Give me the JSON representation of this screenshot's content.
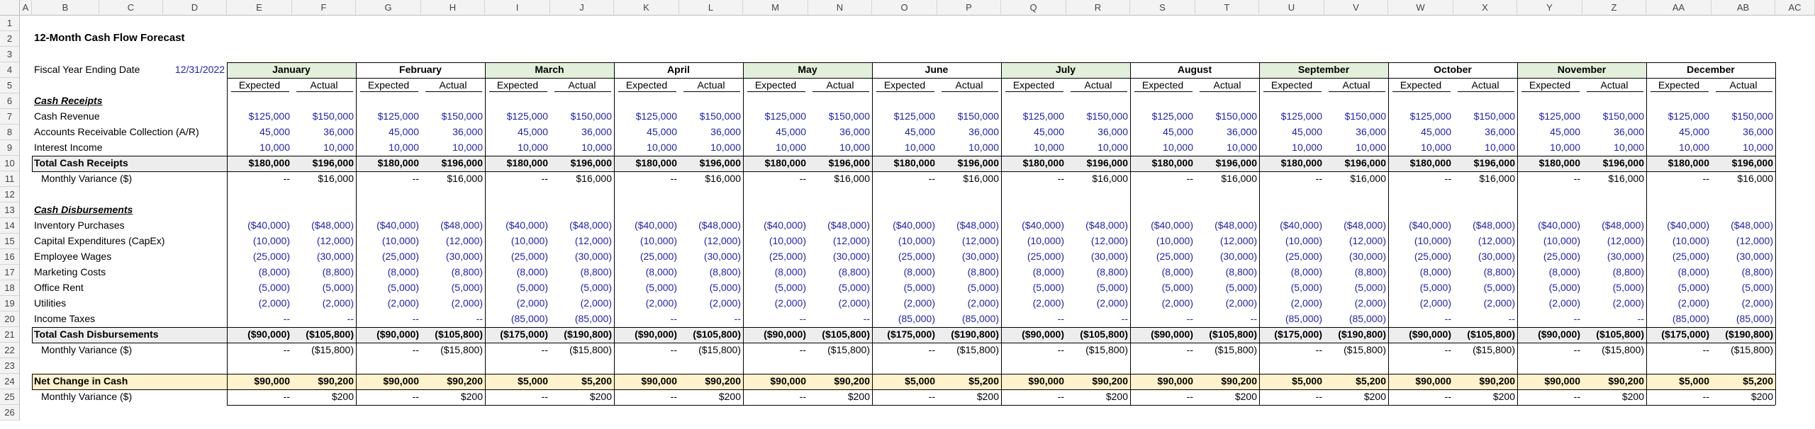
{
  "title": "12-Month Cash Flow Forecast",
  "fiscal_label": "Fiscal Year Ending Date",
  "fiscal_date": "12/31/2022",
  "col_letters": [
    "A",
    "B",
    "C",
    "D",
    "E",
    "F",
    "G",
    "H",
    "I",
    "J",
    "K",
    "L",
    "M",
    "N",
    "O",
    "P",
    "Q",
    "R",
    "S",
    "T",
    "U",
    "V",
    "W",
    "X",
    "Y",
    "Z",
    "AA",
    "AB",
    "AC"
  ],
  "row_numbers": [
    "1",
    "2",
    "3",
    "4",
    "5",
    "6",
    "7",
    "8",
    "9",
    "10",
    "11",
    "12",
    "13",
    "14",
    "15",
    "16",
    "17",
    "18",
    "19",
    "20",
    "21",
    "22",
    "23",
    "24",
    "25",
    "26"
  ],
  "months": [
    "January",
    "February",
    "March",
    "April",
    "May",
    "June",
    "July",
    "August",
    "September",
    "October",
    "November",
    "December"
  ],
  "sub_headers": {
    "expected": "Expected",
    "actual": "Actual"
  },
  "colors": {
    "green_band": "#e2efda",
    "yellow_band": "#fff2cc",
    "grey_band": "#ededed",
    "blue_text": "#1f1fb4"
  },
  "rows": [
    {
      "row": 6,
      "label": "Cash Receipts",
      "style": "section",
      "values": []
    },
    {
      "row": 7,
      "label": "Cash Revenue",
      "style": "input",
      "values": [
        "$125,000",
        "$150,000",
        "$125,000",
        "$150,000",
        "$125,000",
        "$150,000",
        "$125,000",
        "$150,000",
        "$125,000",
        "$150,000",
        "$125,000",
        "$150,000",
        "$125,000",
        "$150,000",
        "$125,000",
        "$150,000",
        "$125,000",
        "$150,000",
        "$125,000",
        "$150,000",
        "$125,000",
        "$150,000",
        "$125,000",
        "$150,000"
      ]
    },
    {
      "row": 8,
      "label": "Accounts Receivable Collection (A/R)",
      "style": "input",
      "values": [
        "45,000",
        "36,000",
        "45,000",
        "36,000",
        "45,000",
        "36,000",
        "45,000",
        "36,000",
        "45,000",
        "36,000",
        "45,000",
        "36,000",
        "45,000",
        "36,000",
        "45,000",
        "36,000",
        "45,000",
        "36,000",
        "45,000",
        "36,000",
        "45,000",
        "36,000",
        "45,000",
        "36,000"
      ]
    },
    {
      "row": 9,
      "label": "Interest Income",
      "style": "input",
      "values": [
        "10,000",
        "10,000",
        "10,000",
        "10,000",
        "10,000",
        "10,000",
        "10,000",
        "10,000",
        "10,000",
        "10,000",
        "10,000",
        "10,000",
        "10,000",
        "10,000",
        "10,000",
        "10,000",
        "10,000",
        "10,000",
        "10,000",
        "10,000",
        "10,000",
        "10,000",
        "10,000",
        "10,000"
      ]
    },
    {
      "row": 10,
      "label": "Total Cash Receipts",
      "style": "total",
      "values": [
        "$180,000",
        "$196,000",
        "$180,000",
        "$196,000",
        "$180,000",
        "$196,000",
        "$180,000",
        "$196,000",
        "$180,000",
        "$196,000",
        "$180,000",
        "$196,000",
        "$180,000",
        "$196,000",
        "$180,000",
        "$196,000",
        "$180,000",
        "$196,000",
        "$180,000",
        "$196,000",
        "$180,000",
        "$196,000",
        "$180,000",
        "$196,000"
      ]
    },
    {
      "row": 11,
      "label": "Monthly Variance ($)",
      "style": "variance",
      "values": [
        "--",
        "$16,000",
        "--",
        "$16,000",
        "--",
        "$16,000",
        "--",
        "$16,000",
        "--",
        "$16,000",
        "--",
        "$16,000",
        "--",
        "$16,000",
        "--",
        "$16,000",
        "--",
        "$16,000",
        "--",
        "$16,000",
        "--",
        "$16,000",
        "--",
        "$16,000"
      ]
    },
    {
      "row": 13,
      "label": "Cash Disbursements",
      "style": "section",
      "values": []
    },
    {
      "row": 14,
      "label": "Inventory Purchases",
      "style": "input",
      "values": [
        "($40,000)",
        "($48,000)",
        "($40,000)",
        "($48,000)",
        "($40,000)",
        "($48,000)",
        "($40,000)",
        "($48,000)",
        "($40,000)",
        "($48,000)",
        "($40,000)",
        "($48,000)",
        "($40,000)",
        "($48,000)",
        "($40,000)",
        "($48,000)",
        "($40,000)",
        "($48,000)",
        "($40,000)",
        "($48,000)",
        "($40,000)",
        "($48,000)",
        "($40,000)",
        "($48,000)"
      ]
    },
    {
      "row": 15,
      "label": "Capital Expenditures (CapEx)",
      "style": "input",
      "values": [
        "(10,000)",
        "(12,000)",
        "(10,000)",
        "(12,000)",
        "(10,000)",
        "(12,000)",
        "(10,000)",
        "(12,000)",
        "(10,000)",
        "(12,000)",
        "(10,000)",
        "(12,000)",
        "(10,000)",
        "(12,000)",
        "(10,000)",
        "(12,000)",
        "(10,000)",
        "(12,000)",
        "(10,000)",
        "(12,000)",
        "(10,000)",
        "(12,000)",
        "(10,000)",
        "(12,000)"
      ]
    },
    {
      "row": 16,
      "label": "Employee Wages",
      "style": "input",
      "values": [
        "(25,000)",
        "(30,000)",
        "(25,000)",
        "(30,000)",
        "(25,000)",
        "(30,000)",
        "(25,000)",
        "(30,000)",
        "(25,000)",
        "(30,000)",
        "(25,000)",
        "(30,000)",
        "(25,000)",
        "(30,000)",
        "(25,000)",
        "(30,000)",
        "(25,000)",
        "(30,000)",
        "(25,000)",
        "(30,000)",
        "(25,000)",
        "(30,000)",
        "(25,000)",
        "(30,000)"
      ]
    },
    {
      "row": 17,
      "label": "Marketing Costs",
      "style": "input",
      "values": [
        "(8,000)",
        "(8,800)",
        "(8,000)",
        "(8,800)",
        "(8,000)",
        "(8,800)",
        "(8,000)",
        "(8,800)",
        "(8,000)",
        "(8,800)",
        "(8,000)",
        "(8,800)",
        "(8,000)",
        "(8,800)",
        "(8,000)",
        "(8,800)",
        "(8,000)",
        "(8,800)",
        "(8,000)",
        "(8,800)",
        "(8,000)",
        "(8,800)",
        "(8,000)",
        "(8,800)"
      ]
    },
    {
      "row": 18,
      "label": "Office Rent",
      "style": "input",
      "values": [
        "(5,000)",
        "(5,000)",
        "(5,000)",
        "(5,000)",
        "(5,000)",
        "(5,000)",
        "(5,000)",
        "(5,000)",
        "(5,000)",
        "(5,000)",
        "(5,000)",
        "(5,000)",
        "(5,000)",
        "(5,000)",
        "(5,000)",
        "(5,000)",
        "(5,000)",
        "(5,000)",
        "(5,000)",
        "(5,000)",
        "(5,000)",
        "(5,000)",
        "(5,000)",
        "(5,000)"
      ]
    },
    {
      "row": 19,
      "label": "Utilities",
      "style": "input",
      "values": [
        "(2,000)",
        "(2,000)",
        "(2,000)",
        "(2,000)",
        "(2,000)",
        "(2,000)",
        "(2,000)",
        "(2,000)",
        "(2,000)",
        "(2,000)",
        "(2,000)",
        "(2,000)",
        "(2,000)",
        "(2,000)",
        "(2,000)",
        "(2,000)",
        "(2,000)",
        "(2,000)",
        "(2,000)",
        "(2,000)",
        "(2,000)",
        "(2,000)",
        "(2,000)",
        "(2,000)"
      ]
    },
    {
      "row": 20,
      "label": "Income Taxes",
      "style": "input",
      "values": [
        "--",
        "--",
        "--",
        "--",
        "(85,000)",
        "(85,000)",
        "--",
        "--",
        "--",
        "--",
        "(85,000)",
        "(85,000)",
        "--",
        "--",
        "--",
        "--",
        "(85,000)",
        "(85,000)",
        "--",
        "--",
        "--",
        "--",
        "(85,000)",
        "(85,000)"
      ]
    },
    {
      "row": 21,
      "label": "Total Cash Disbursements",
      "style": "total",
      "values": [
        "($90,000)",
        "($105,800)",
        "($90,000)",
        "($105,800)",
        "($175,000)",
        "($190,800)",
        "($90,000)",
        "($105,800)",
        "($90,000)",
        "($105,800)",
        "($175,000)",
        "($190,800)",
        "($90,000)",
        "($105,800)",
        "($90,000)",
        "($105,800)",
        "($175,000)",
        "($190,800)",
        "($90,000)",
        "($105,800)",
        "($90,000)",
        "($105,800)",
        "($175,000)",
        "($190,800)"
      ]
    },
    {
      "row": 22,
      "label": "Monthly Variance ($)",
      "style": "variance",
      "values": [
        "--",
        "($15,800)",
        "--",
        "($15,800)",
        "--",
        "($15,800)",
        "--",
        "($15,800)",
        "--",
        "($15,800)",
        "--",
        "($15,800)",
        "--",
        "($15,800)",
        "--",
        "($15,800)",
        "--",
        "($15,800)",
        "--",
        "($15,800)",
        "--",
        "($15,800)",
        "--",
        "($15,800)"
      ]
    },
    {
      "row": 24,
      "label": "Net Change in Cash",
      "style": "net",
      "values": [
        "$90,000",
        "$90,200",
        "$90,000",
        "$90,200",
        "$5,000",
        "$5,200",
        "$90,000",
        "$90,200",
        "$90,000",
        "$90,200",
        "$5,000",
        "$5,200",
        "$90,000",
        "$90,200",
        "$90,000",
        "$90,200",
        "$5,000",
        "$5,200",
        "$90,000",
        "$90,200",
        "$90,000",
        "$90,200",
        "$5,000",
        "$5,200"
      ]
    },
    {
      "row": 25,
      "label": "Monthly Variance ($)",
      "style": "variance",
      "values": [
        "--",
        "$200",
        "--",
        "$200",
        "--",
        "$200",
        "--",
        "$200",
        "--",
        "$200",
        "--",
        "$200",
        "--",
        "$200",
        "--",
        "$200",
        "--",
        "$200",
        "--",
        "$200",
        "--",
        "$200",
        "--",
        "$200"
      ]
    }
  ]
}
